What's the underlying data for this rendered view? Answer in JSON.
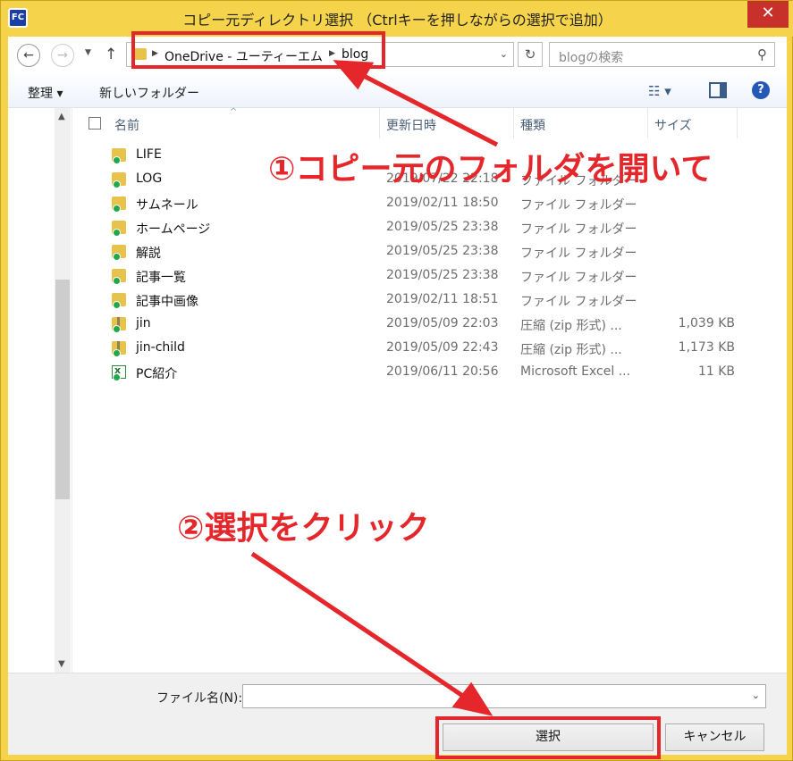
{
  "window": {
    "title": "コピー元ディレクトリ選択 （Ctrlキーを押しながらの選択で追加）",
    "app_icon_text": "FC",
    "close_glyph": "✕"
  },
  "nav": {
    "back_glyph": "←",
    "forward_glyph": "→",
    "up_glyph": "↑",
    "breadcrumb": [
      "OneDrive - ユーティーエム",
      "blog"
    ],
    "refresh_glyph": "↻",
    "search_placeholder": "blogの検索",
    "search_glyph": "⚲"
  },
  "toolbar": {
    "organize_label": "整理 ▾",
    "new_folder_label": "新しいフォルダー",
    "view_glyph": "☷ ▾",
    "help_glyph": "?"
  },
  "columns": {
    "name": "名前",
    "date": "更新日時",
    "type": "種類",
    "size": "サイズ"
  },
  "files": [
    {
      "name": "LIFE",
      "date": "",
      "type": "",
      "size": "",
      "icon": "folder-icon"
    },
    {
      "name": "LOG",
      "date": "2019/07/22 22:18",
      "type": "ファイル フォルダー",
      "size": "",
      "icon": "folder-icon"
    },
    {
      "name": "サムネール",
      "date": "2019/02/11 18:50",
      "type": "ファイル フォルダー",
      "size": "",
      "icon": "folder-icon"
    },
    {
      "name": "ホームページ",
      "date": "2019/05/25 23:38",
      "type": "ファイル フォルダー",
      "size": "",
      "icon": "folder-icon"
    },
    {
      "name": "解説",
      "date": "2019/05/25 23:38",
      "type": "ファイル フォルダー",
      "size": "",
      "icon": "folder-icon"
    },
    {
      "name": "記事一覧",
      "date": "2019/05/25 23:38",
      "type": "ファイル フォルダー",
      "size": "",
      "icon": "folder-icon"
    },
    {
      "name": "記事中画像",
      "date": "2019/02/11 18:51",
      "type": "ファイル フォルダー",
      "size": "",
      "icon": "folder-icon"
    },
    {
      "name": "jin",
      "date": "2019/05/09 22:03",
      "type": "圧縮 (zip 形式) ...",
      "size": "1,039 KB",
      "icon": "zip-icon"
    },
    {
      "name": "jin-child",
      "date": "2019/05/09 22:43",
      "type": "圧縮 (zip 形式) ...",
      "size": "1,173 KB",
      "icon": "zip-icon"
    },
    {
      "name": "PC紹介",
      "date": "2019/06/11 20:56",
      "type": "Microsoft Excel ...",
      "size": "11 KB",
      "icon": "excel-icon"
    }
  ],
  "bottom": {
    "filename_label": "ファイル名(N):",
    "filename_value": "",
    "select_button": "選択",
    "cancel_button": "キャンセル"
  },
  "annotations": {
    "step1": "①コピー元のフォルダを開いて",
    "step2": "②選択をクリック",
    "color": "#e5262b"
  }
}
